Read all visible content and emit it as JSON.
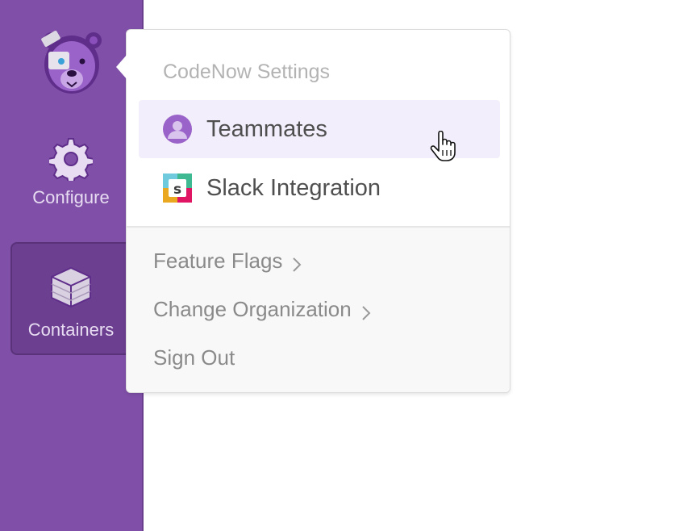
{
  "sidebar": {
    "logo_icon": "bear-mascot-icon",
    "items": [
      {
        "label": "Configure",
        "icon": "gear-icon"
      },
      {
        "label": "Containers",
        "icon": "box-icon"
      }
    ]
  },
  "dropdown": {
    "header": "CodeNow Settings",
    "items": [
      {
        "label": "Teammates",
        "icon": "user-avatar-icon"
      },
      {
        "label": "Slack Integration",
        "icon": "slack-icon"
      }
    ],
    "sub_items": [
      {
        "label": "Feature Flags",
        "icon": "chevron-right-icon"
      },
      {
        "label": "Change Organization",
        "icon": "chevron-right-icon"
      },
      {
        "label": "Sign Out"
      }
    ]
  },
  "colors": {
    "sidebar": "#8050a8",
    "sidebar_active": "#6c3f90",
    "highlight": "#f3eefb",
    "text_primary": "#4f4f4f",
    "text_muted": "#8a8a8a"
  }
}
